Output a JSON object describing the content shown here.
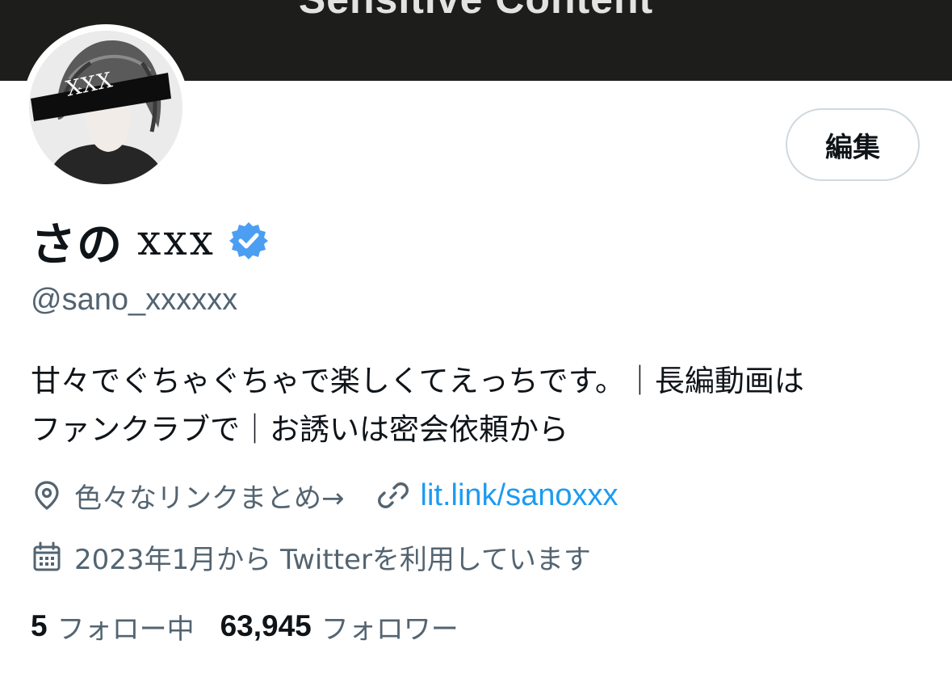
{
  "banner": {
    "text": "Sensitive Content"
  },
  "avatar": {
    "label": "XXX"
  },
  "edit_button": {
    "label": "編集"
  },
  "profile": {
    "name": "さの",
    "name_suffix": "xxx",
    "handle": "@sano_xxxxxx",
    "verified_color": "#4c9ef3",
    "bio_line1": "甘々でぐちゃぐちゃで楽しくてえっちです。｜長編動画は",
    "bio_line2": "ファンクラブで｜お誘いは密会依頼から"
  },
  "meta": {
    "location_icon": "location-pin-icon",
    "location_text": "色々なリンクまとめ→",
    "link_icon": "link-icon",
    "link_text": "lit.link/sanoxxx",
    "joined_icon": "calendar-icon",
    "joined_text": "2023年1月から Twitterを利用しています"
  },
  "stats": {
    "following_count": "5",
    "following_label": "フォロー中",
    "followers_count": "63,945",
    "followers_label": "フォロワー"
  },
  "colors": {
    "link": "#1d9bf0",
    "secondary_text": "#536471",
    "primary_text": "#0f1419",
    "banner_bg": "#1d1e1c"
  }
}
